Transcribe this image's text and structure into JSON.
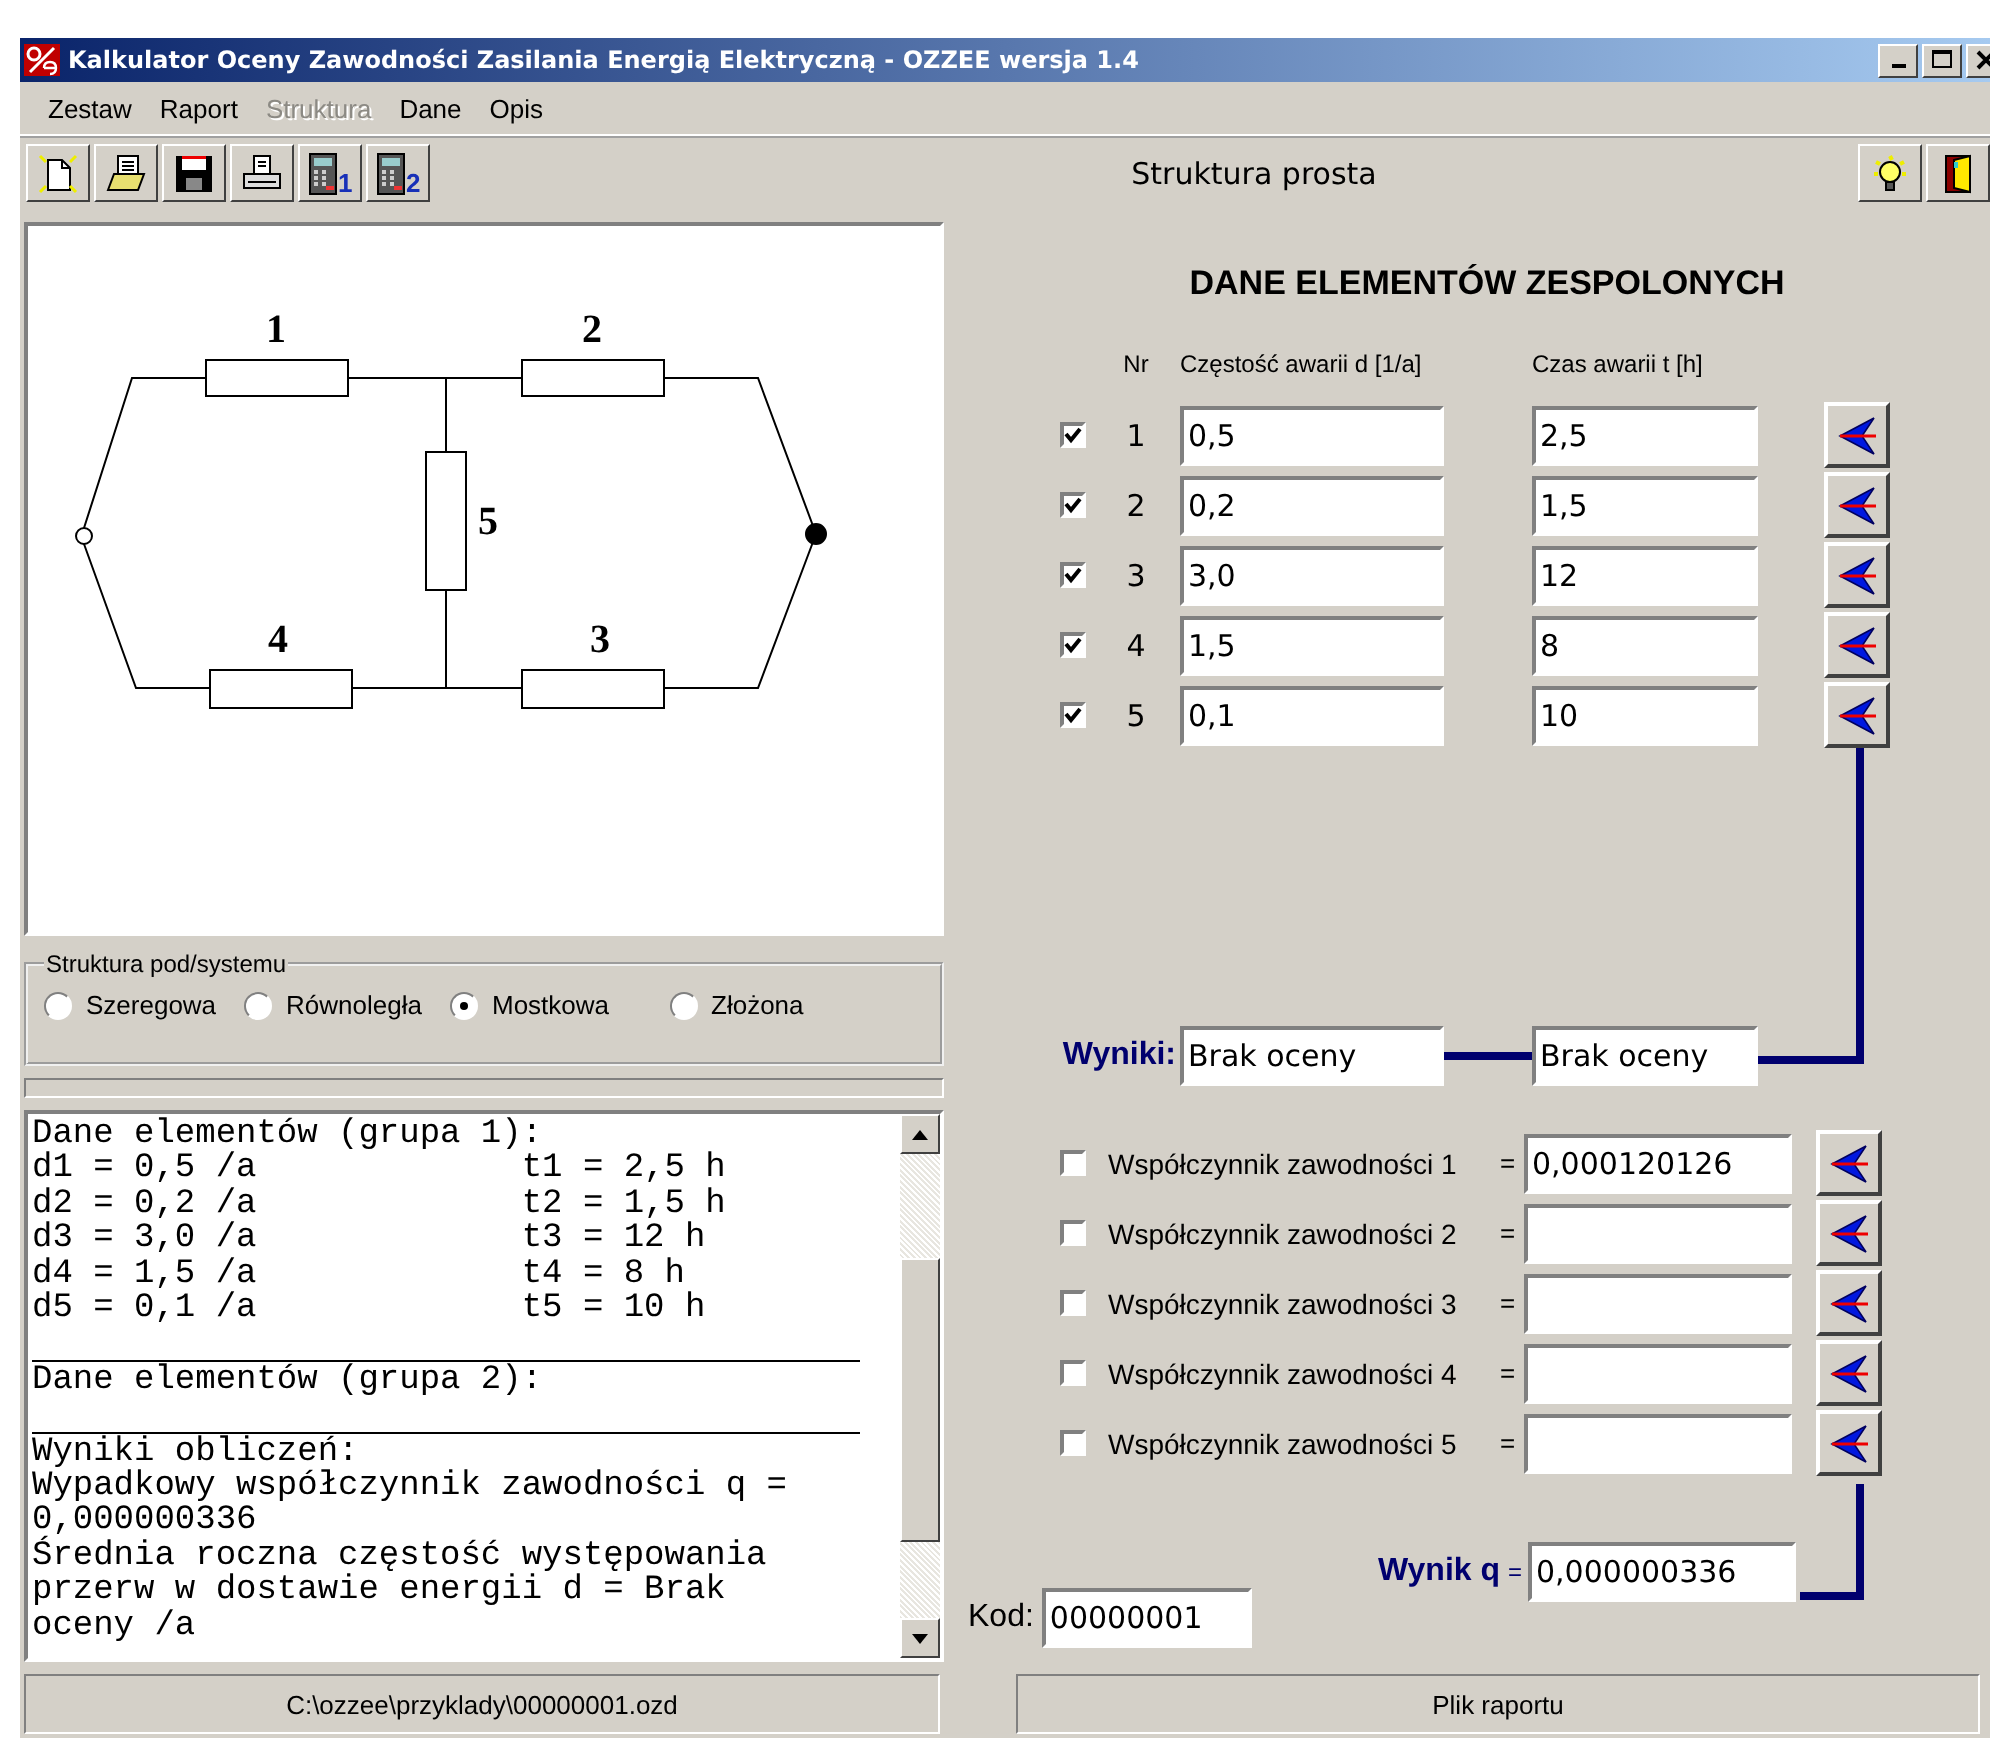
{
  "window": {
    "title": "Kalkulator Oceny Zawodności Zasilania Energią Elektryczną - OZZEE wersja 1.4"
  },
  "menu": [
    {
      "label": "Zestaw",
      "disabled": false
    },
    {
      "label": "Raport",
      "disabled": false
    },
    {
      "label": "Struktura",
      "disabled": true
    },
    {
      "label": "Dane",
      "disabled": false
    },
    {
      "label": "Opis",
      "disabled": false
    }
  ],
  "toolbar": {
    "buttons": [
      {
        "kind": "new"
      },
      {
        "kind": "open"
      },
      {
        "kind": "save"
      },
      {
        "kind": "print"
      },
      {
        "kind": "calc",
        "badge": "1"
      },
      {
        "kind": "calc",
        "badge": "2"
      }
    ],
    "caption": "Struktura prosta",
    "right_buttons": [
      {
        "kind": "hint"
      },
      {
        "kind": "exit"
      }
    ]
  },
  "diagram": {
    "labels": [
      "1",
      "2",
      "5",
      "4",
      "3"
    ]
  },
  "structure_group": {
    "title": "Struktura pod/systemu",
    "options": [
      {
        "label": "Szeregowa",
        "selected": false
      },
      {
        "label": "Równoległa",
        "selected": false
      },
      {
        "label": "Mostkowa",
        "selected": true
      },
      {
        "label": "Złożona",
        "selected": false
      }
    ]
  },
  "report": {
    "lines": [
      {
        "kind": "text",
        "text": "Dane elementów (grupa 1):"
      },
      {
        "kind": "text",
        "text": "d1 = 0,5 /a             t1 = 2,5 h"
      },
      {
        "kind": "text",
        "text": "d2 = 0,2 /a             t2 = 1,5 h"
      },
      {
        "kind": "text",
        "text": "d3 = 3,0 /a             t3 = 12 h"
      },
      {
        "kind": "text",
        "text": "d4 = 1,5 /a             t4 = 8 h"
      },
      {
        "kind": "text",
        "text": "d5 = 0,1 /a             t5 = 10 h"
      },
      {
        "kind": "rule"
      },
      {
        "kind": "text",
        "text": "Dane elementów (grupa 2):"
      },
      {
        "kind": "rule"
      },
      {
        "kind": "text",
        "text": "Wyniki obliczeń:"
      },
      {
        "kind": "text",
        "text": "Wypadkowy współczynnik zawodności q ="
      },
      {
        "kind": "text",
        "text": "0,000000336"
      },
      {
        "kind": "text",
        "text": "Średnia roczna częstość występowania"
      },
      {
        "kind": "text",
        "text": "przerw w dostawie energii d = Brak"
      },
      {
        "kind": "text",
        "text": "oceny /a"
      }
    ]
  },
  "elements": {
    "title": "DANE ELEMENTÓW ZESPOLONYCH",
    "columns": [
      "Nr",
      "Częstość awarii d [1/a]",
      "Czas awarii t [h]"
    ],
    "rows": [
      {
        "checked": true,
        "nr": "1",
        "d": "0,5",
        "t": "2,5"
      },
      {
        "checked": true,
        "nr": "2",
        "d": "0,2",
        "t": "1,5"
      },
      {
        "checked": true,
        "nr": "3",
        "d": "3,0",
        "t": "12"
      },
      {
        "checked": true,
        "nr": "4",
        "d": "1,5",
        "t": "8"
      },
      {
        "checked": true,
        "nr": "5",
        "d": "0,1",
        "t": "10"
      }
    ]
  },
  "results": {
    "label": "Wyniki:",
    "values": [
      "Brak oceny",
      "Brak oceny"
    ]
  },
  "coefficients": [
    {
      "checked": false,
      "label": "Współczynnik zawodności 1",
      "eq": "=",
      "value": "0,000120126"
    },
    {
      "checked": false,
      "label": "Współczynnik zawodności 2",
      "eq": "="
    },
    {
      "checked": false,
      "label": "Współczynnik zawodności 3",
      "eq": "="
    },
    {
      "checked": false,
      "label": "Współczynnik zawodności 4",
      "eq": "="
    },
    {
      "checked": false,
      "label": "Współczynnik zawodności 5",
      "eq": "="
    }
  ],
  "wynik_q": {
    "label": "Wynik q",
    "eq": "=",
    "value": "0,000000336"
  },
  "kod": {
    "label": "Kod:",
    "value": "00000001"
  },
  "status_bar": [
    "C:\\ozzee\\przyklady\\00000001.ozd",
    "Plik raportu"
  ]
}
